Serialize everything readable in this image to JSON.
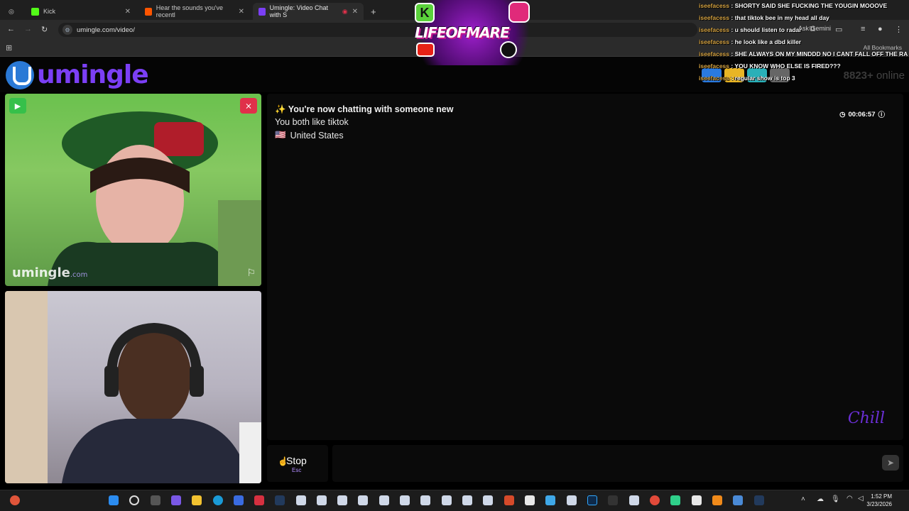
{
  "browser": {
    "tabs": [
      {
        "label": "Kick",
        "favicon_color": "#53fc18"
      },
      {
        "label": "Hear the sounds you've recentl",
        "favicon_color": "#ff5500"
      },
      {
        "label": "Umingle: Video Chat with S",
        "favicon_color": "#7b3ff5"
      }
    ],
    "new_tab": "+",
    "url": "umingle.com/video/",
    "bookmarks_label": "All Bookmarks",
    "ask_gemini": "Ask Gemini"
  },
  "site": {
    "logo_text": "umingle",
    "online_count": "8823+",
    "online_label": "online"
  },
  "video_top": {
    "watermark": "umingle",
    "watermark_suffix": ".com",
    "play_icon": "play-icon",
    "camera_off_icon": "camera-off-icon",
    "report_icon": "flag-icon"
  },
  "chat": {
    "line1": "✨ You're now chatting with someone new",
    "line2": "You both like tiktok",
    "country_flag": "🇺🇸",
    "country": "United States",
    "timer": "00:06:57",
    "overlay_signature": "Chill"
  },
  "controls": {
    "stop_label": "Stop",
    "stop_key": "Esc",
    "message_placeholder": "",
    "send_icon": "send-icon"
  },
  "stream_overlay": {
    "logo_text": "LIFEOFMARE",
    "logo_k": "K",
    "chat": [
      {
        "user": "iseefacess",
        "msg": "SHORTY SAID SHE FUCKING THE YOUGIN MOOOVE"
      },
      {
        "user": "iseefacess",
        "msg": "that tiktok bee in my head all day"
      },
      {
        "user": "iseefacess",
        "msg": "u should listen to radar"
      },
      {
        "user": "iseefacess",
        "msg": "he look like a dbd killer"
      },
      {
        "user": "iseefacess",
        "msg": "SHE ALWAYS ON MY MINDDD NO I CANT FALL OFF THE RA"
      },
      {
        "user": "iseefacess",
        "msg": "YOU KNOW WHO ELSE IS FIRED???"
      },
      {
        "user": "iseefacess",
        "msg": "regular show is top 3"
      }
    ]
  },
  "taskbar": {
    "time": "1:52 PM",
    "date": "3/23/2026"
  }
}
